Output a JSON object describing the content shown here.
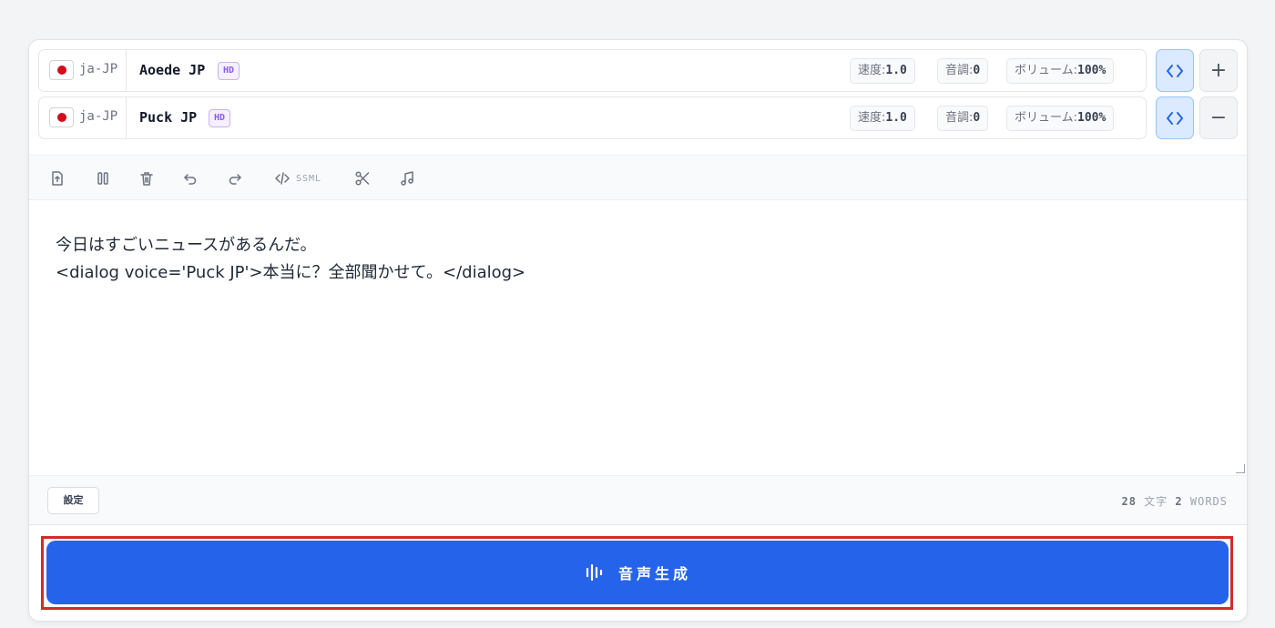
{
  "voices": [
    {
      "lang": "ja-JP",
      "name": "Aoede JP",
      "badge": "HD",
      "speed_label": "速度:",
      "speed": "1.0",
      "pitch_label": "音調:",
      "pitch": "0",
      "volume_label": "ボリューム:",
      "volume": "100%",
      "action_icon": "plus-icon",
      "action_symbol": "+"
    },
    {
      "lang": "ja-JP",
      "name": "Puck JP",
      "badge": "HD",
      "speed_label": "速度:",
      "speed": "1.0",
      "pitch_label": "音調:",
      "pitch": "0",
      "volume_label": "ボリューム:",
      "volume": "100%",
      "action_icon": "minus-icon",
      "action_symbol": "−"
    }
  ],
  "toolbar": {
    "ssml_label": "SSML",
    "icons": [
      "upload-file-icon",
      "pause-icon",
      "trash-icon",
      "undo-icon",
      "redo-icon",
      "code-icon",
      "scissors-icon",
      "music-note-icon"
    ]
  },
  "editor": {
    "lines": [
      "今日はすごいニュースがあるんだ。",
      "<dialog voice='Puck JP'>本当に？全部聞かせて。</dialog>"
    ]
  },
  "footer": {
    "settings_label": "設定",
    "char_count": "28",
    "char_unit": "文字",
    "word_count": "2",
    "word_unit": "WORDS"
  },
  "generate": {
    "label": "音声生成",
    "icon": "audio-wave-icon"
  },
  "colors": {
    "accent": "#2563eb",
    "flag_red": "#d30b1c",
    "badge_purple": "#8b5cf6",
    "highlight": "#d42a2a"
  }
}
